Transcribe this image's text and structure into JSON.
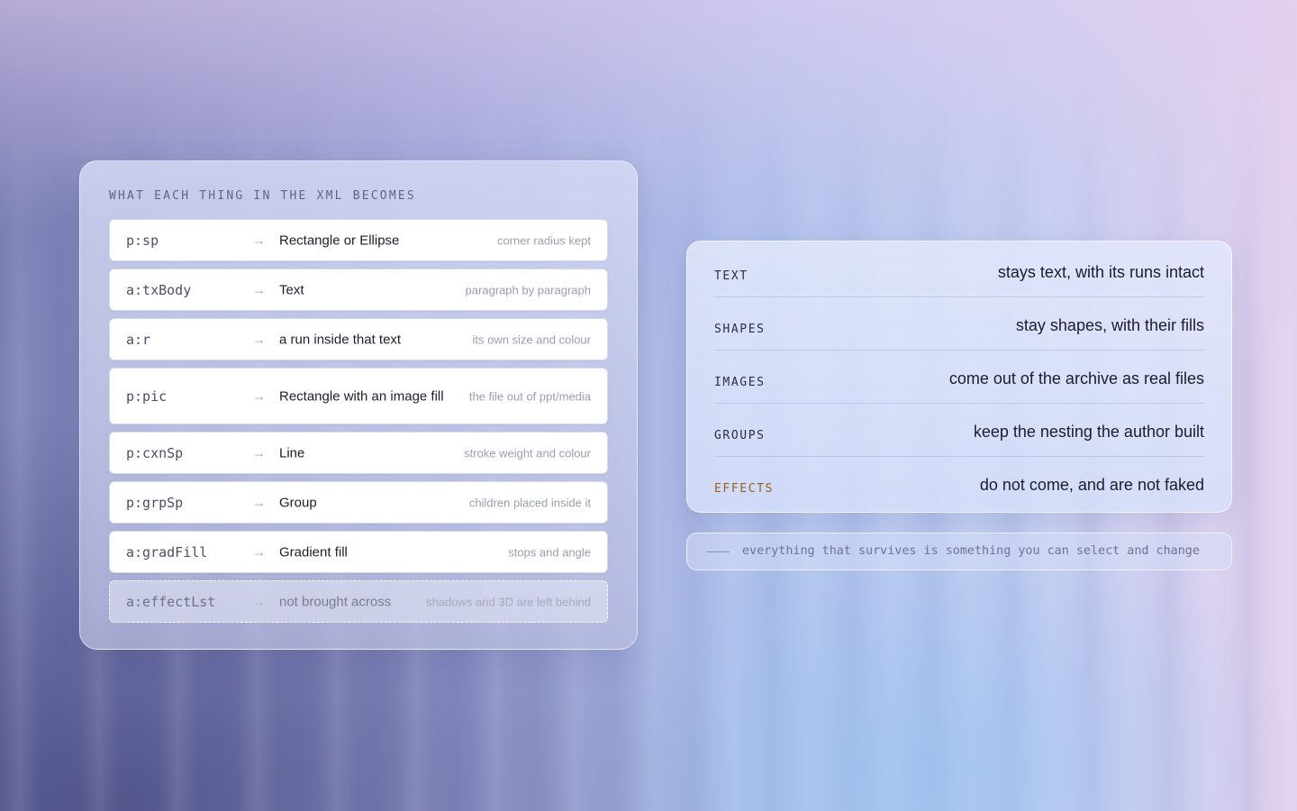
{
  "mapping_panel": {
    "heading": "WHAT EACH THING IN THE XML BECOMES",
    "arrow_glyph": "→",
    "rows": [
      {
        "code": "p:sp",
        "target": "Rectangle or Ellipse",
        "note": "corner radius kept"
      },
      {
        "code": "a:txBody",
        "target": "Text",
        "note": "paragraph by paragraph"
      },
      {
        "code": "a:r",
        "target": "a run inside that text",
        "note": "its own size and colour"
      },
      {
        "code": "p:pic",
        "target": "Rectangle with an image fill",
        "note": "the file out of ppt/media"
      },
      {
        "code": "p:cxnSp",
        "target": "Line",
        "note": "stroke weight and colour"
      },
      {
        "code": "p:grpSp",
        "target": "Group",
        "note": "children placed inside it"
      },
      {
        "code": "a:gradFill",
        "target": "Gradient fill",
        "note": "stops and angle"
      },
      {
        "code": "a:effectLst",
        "target": "not brought across",
        "note": "shadows and 3D are left behind"
      }
    ]
  },
  "survival_panel": {
    "rows": [
      {
        "kind": "TEXT",
        "fate": "stays text, with its runs intact"
      },
      {
        "kind": "SHAPES",
        "fate": "stay shapes, with their fills"
      },
      {
        "kind": "IMAGES",
        "fate": "come out of the archive as real files"
      },
      {
        "kind": "GROUPS",
        "fate": "keep the nesting the author built"
      },
      {
        "kind": "EFFECTS",
        "fate": "do not come, and are not faked"
      }
    ],
    "warning_color": "#9a5b24"
  },
  "footer": {
    "text": "everything that survives is something you can select and change"
  }
}
